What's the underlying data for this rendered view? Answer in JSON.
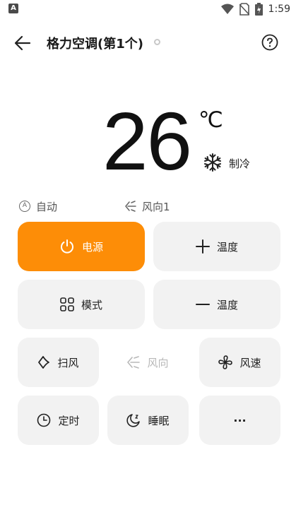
{
  "status_bar": {
    "left_icon_letter": "A",
    "time": "1:59",
    "icons": [
      "wifi-icon",
      "no-sim-icon",
      "battery-charging-icon"
    ]
  },
  "header": {
    "title": "格力空调(第1个)",
    "back_icon": "arrow-left-icon",
    "help_icon": "question-circle-icon"
  },
  "display": {
    "temperature": "26",
    "unit": "℃",
    "mode_icon": "snowflake-icon",
    "mode_label": "制冷"
  },
  "info": {
    "auto_badge": "A",
    "auto_label": "自动",
    "wind_label": "风向1"
  },
  "controls": {
    "power": "电源",
    "temp_up": "温度",
    "mode": "模式",
    "temp_down": "温度",
    "sweep": "扫风",
    "direction": "风向",
    "speed": "风速",
    "timer": "定时",
    "sleep": "睡眠",
    "more": "···"
  },
  "colors": {
    "accent": "#fd8d07",
    "button_bg": "#f2f2f2",
    "disabled_text": "#b8b8b8"
  }
}
